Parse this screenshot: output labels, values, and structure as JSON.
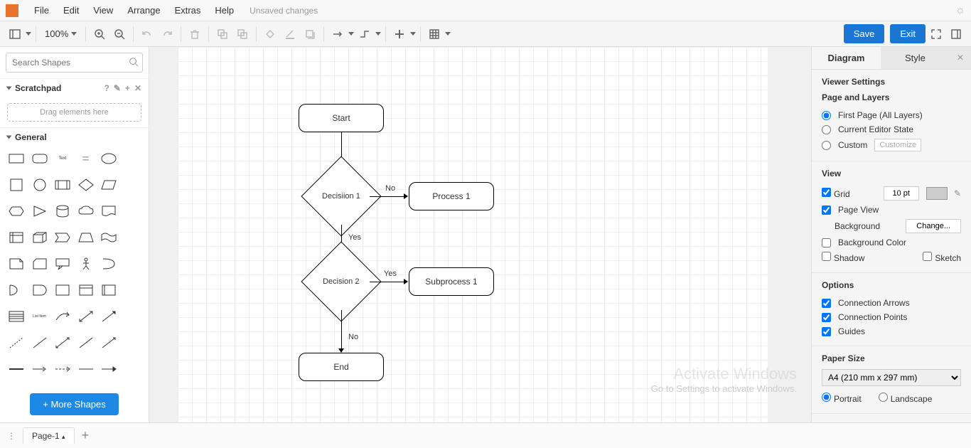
{
  "menu": {
    "file": "File",
    "edit": "Edit",
    "view": "View",
    "arrange": "Arrange",
    "extras": "Extras",
    "help": "Help"
  },
  "status": "Unsaved changes",
  "zoom": "100%",
  "buttons": {
    "save": "Save",
    "exit": "Exit",
    "more_shapes": "+ More Shapes",
    "change": "Change..."
  },
  "search": {
    "placeholder": "Search Shapes"
  },
  "sidebar": {
    "scratchpad": "Scratchpad",
    "drag_hint": "Drag elements here",
    "general": "General",
    "scratch_help": "?"
  },
  "flow": {
    "start": "Start",
    "d1": "Decisiion 1",
    "d2": "Decision 2",
    "p1": "Process 1",
    "sp1": "Subprocess 1",
    "end": "End",
    "no": "No",
    "yes": "Yes"
  },
  "panel": {
    "tabs": {
      "diagram": "Diagram",
      "style": "Style"
    },
    "viewer": "Viewer Settings",
    "page_layers": "Page and Layers",
    "r_first": "First Page (All Layers)",
    "r_current": "Current Editor State",
    "r_custom": "Custom",
    "customize": "Customize",
    "view": "View",
    "grid": "Grid",
    "grid_val": "10 pt",
    "pageview": "Page View",
    "background": "Background",
    "bgcolor": "Background Color",
    "shadow": "Shadow",
    "sketch": "Sketch",
    "options": "Options",
    "conn_arrows": "Connection Arrows",
    "conn_points": "Connection Points",
    "guides": "Guides",
    "paper": "Paper Size",
    "paper_val": "A4 (210 mm x 297 mm)",
    "portrait": "Portrait",
    "landscape": "Landscape"
  },
  "page_tab": "Page-1",
  "watermark": {
    "title": "Activate Windows",
    "sub": "Go to Settings to activate Windows."
  }
}
